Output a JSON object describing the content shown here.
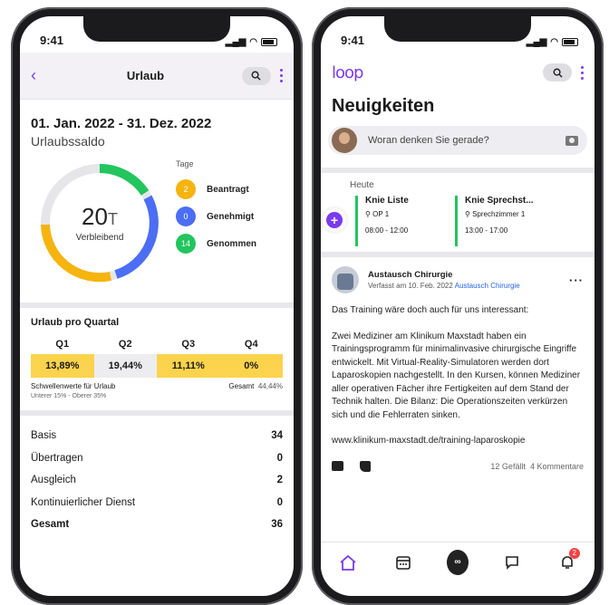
{
  "status_time": "9:41",
  "left": {
    "title": "Urlaub",
    "range": "01. Jan. 2022 - 31. Dez. 2022",
    "saldo": "Urlaubssaldo",
    "donut": {
      "value": "20",
      "unit": "T",
      "label": "Verbleibend"
    },
    "legend_head": "Tage",
    "legend": [
      {
        "count": "2",
        "label": "Beantragt",
        "color": "#f6b40e"
      },
      {
        "count": "0",
        "label": "Genehmigt",
        "color": "#4b6ef5"
      },
      {
        "count": "14",
        "label": "Genommen",
        "color": "#22c55e"
      }
    ],
    "quarter_title": "Urlaub pro Quartal",
    "quarters": [
      {
        "head": "Q1",
        "value": "13,89%",
        "bg": "#fcd34d"
      },
      {
        "head": "Q2",
        "value": "19,44%",
        "bg": "#f1f1f3"
      },
      {
        "head": "Q3",
        "value": "11,11%",
        "bg": "#fcd34d"
      },
      {
        "head": "Q4",
        "value": "0%",
        "bg": "#fcd34d"
      }
    ],
    "thresh_label": "Schwellenwerte für Urlaub",
    "total_label": "Gesamt",
    "total_value": "44,44%",
    "thresh_sub": "Unterer 15% - Oberer 35%",
    "rows": [
      {
        "k": "Basis",
        "v": "34"
      },
      {
        "k": "Übertragen",
        "v": "0"
      },
      {
        "k": "Ausgleich",
        "v": "2"
      },
      {
        "k": "Kontinuierlicher Dienst",
        "v": "0"
      },
      {
        "k": "Gesamt",
        "v": "36"
      }
    ]
  },
  "right": {
    "logo": "loop",
    "title": "Neuigkeiten",
    "composer_placeholder": "Woran denken Sie gerade?",
    "today": "Heute",
    "events": [
      {
        "title": "Knie Liste",
        "loc": "OP 1",
        "time": "08:00 - 12:00"
      },
      {
        "title": "Knie Sprechst...",
        "loc": "Sprechzimmer 1",
        "time": "13:00 - 17:00"
      }
    ],
    "post": {
      "author": "Austausch Chirurgie",
      "meta": "Verfasst am 10. Feb. 2022",
      "meta_link": "Austausch Chirurgie",
      "p1": "Das Training wäre doch auch für uns interessant:",
      "p2": "Zwei Mediziner am Klinikum Maxstadt haben ein Trainingsprogramm für minimalinvasive chirurgische Eingriffe entwickelt. Mit Virtual-Reality-Simulatoren werden dort Laparoskopien nachgestellt. In den Kursen, können Mediziner aller operativen Fächer ihre Fertigkeiten auf dem Stand der Technik halten. Die Bilanz: Die Operationszeiten verkürzen sich und die Fehlerraten sinken.",
      "p3": "www.klinikum-maxstadt.de/training-laparoskopie",
      "likes": "12 Gefällt",
      "comments": "4 Kommentare"
    },
    "center_tab": "∞",
    "notif_count": "2"
  }
}
